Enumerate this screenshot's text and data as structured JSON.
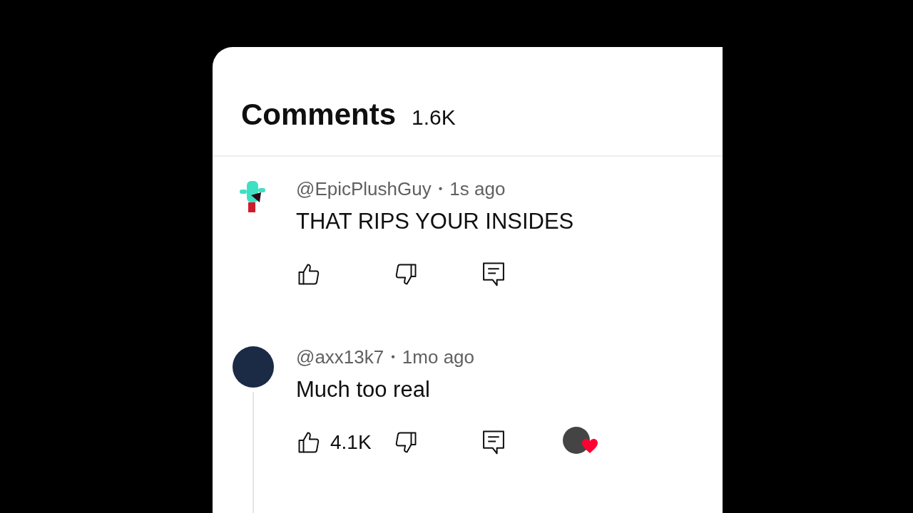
{
  "header": {
    "title": "Comments",
    "count": "1.6K"
  },
  "comments": [
    {
      "kind": "cartoon",
      "author": "@EpicPlushGuy",
      "separator": "•",
      "time": "1s ago",
      "text": "THAT RIPS YOUR INSIDES",
      "hearted": false,
      "has_replies": false
    },
    {
      "kind": "photo",
      "author": "@axx13k7",
      "separator": "•",
      "time": "1mo ago",
      "text": "Much too real",
      "likes": "4.1K",
      "hearted": true,
      "has_replies": true
    }
  ]
}
